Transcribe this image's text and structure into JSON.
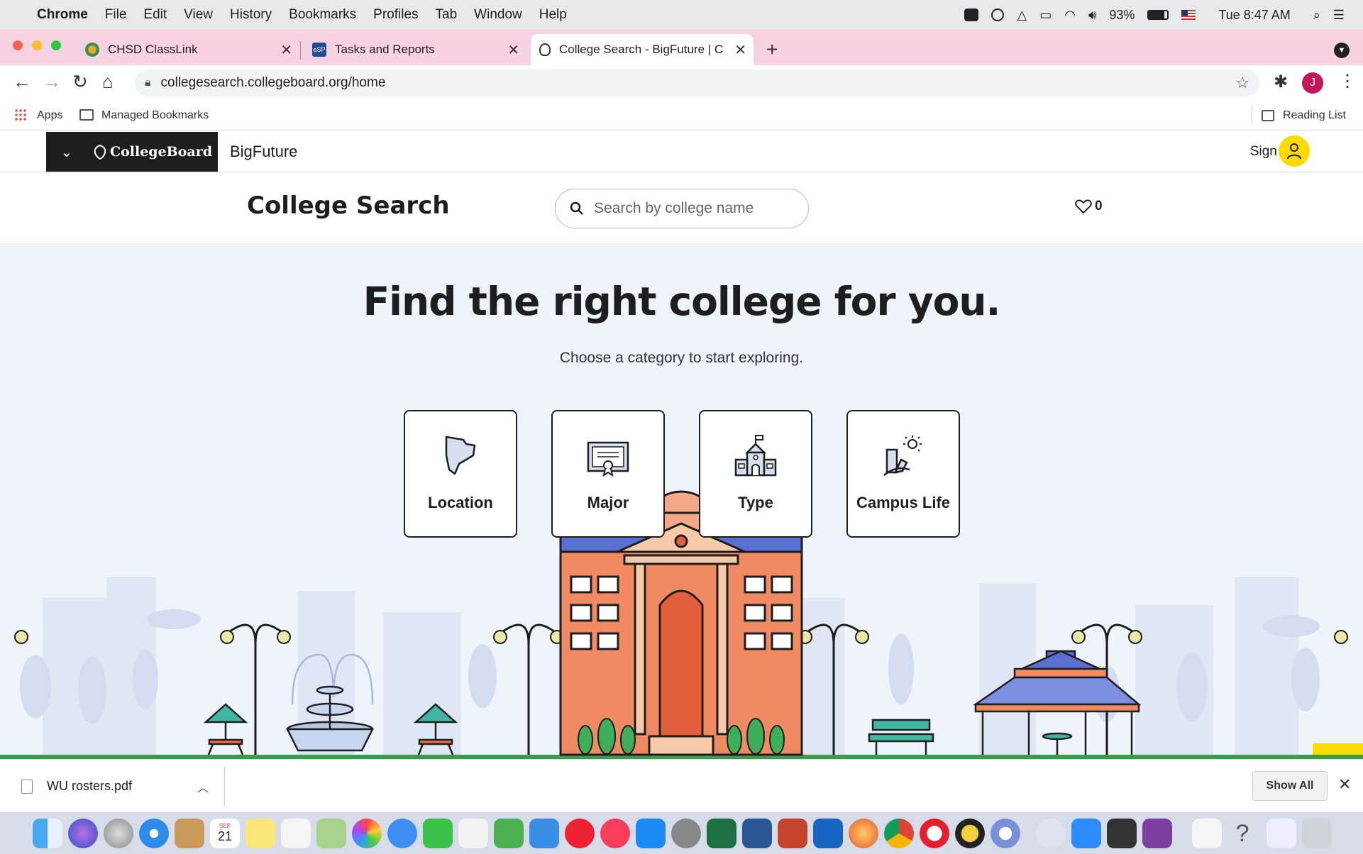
{
  "menubar": {
    "app_name": "Chrome",
    "items": [
      "File",
      "Edit",
      "View",
      "History",
      "Bookmarks",
      "Profiles",
      "Tab",
      "Window",
      "Help"
    ],
    "battery": "93%",
    "clock": "Tue 8:47 AM"
  },
  "tabs": [
    {
      "title": "CHSD ClassLink"
    },
    {
      "title": "Tasks and Reports"
    },
    {
      "title": "College Search - BigFuture | C"
    }
  ],
  "omnibox": {
    "url": "collegesearch.collegeboard.org/home"
  },
  "profile_initial": "J",
  "bookmarks": {
    "apps": "Apps",
    "managed": "Managed Bookmarks",
    "reading_list": "Reading List"
  },
  "site": {
    "logo_text": "CollegeBoard",
    "product": "BigFuture",
    "sign_in": "Sign In",
    "page_title": "College Search",
    "search_placeholder": "Search by college name",
    "favorites_count": "0"
  },
  "hero": {
    "title": "Find the right college for you.",
    "subtitle": "Choose a category to start exploring.",
    "categories": [
      {
        "label": "Location",
        "icon": "map-shape-icon"
      },
      {
        "label": "Major",
        "icon": "diploma-icon"
      },
      {
        "label": "Type",
        "icon": "school-building-icon"
      },
      {
        "label": "Campus Life",
        "icon": "campus-life-icon"
      }
    ]
  },
  "downloads": {
    "file": "WU rosters.pdf",
    "show_all": "Show All"
  },
  "dock": {
    "calendar_day": "21",
    "calendar_month": "SEP"
  },
  "colors": {
    "tab_strip": "#f6d2e2",
    "header_dark": "#1e1e1e",
    "accent_yellow": "#fedb00",
    "hero_bg": "#eff3fa"
  }
}
